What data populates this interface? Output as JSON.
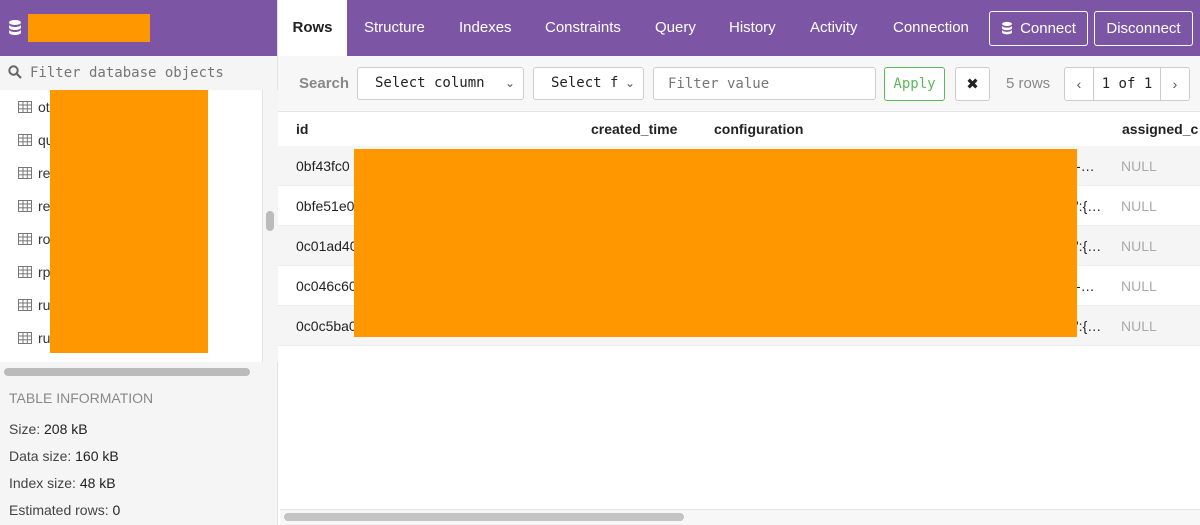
{
  "sidebar": {
    "filter_placeholder": "Filter database objects",
    "items": [
      {
        "label": "ot"
      },
      {
        "label": "qu"
      },
      {
        "label": "re"
      },
      {
        "label": "re"
      },
      {
        "label": "ro"
      },
      {
        "label": "rp"
      },
      {
        "label": "ru"
      },
      {
        "label": "ru"
      }
    ]
  },
  "table_info": {
    "title": "TABLE INFORMATION",
    "size_label": "Size:",
    "size_value": "208 kB",
    "data_label": "Data size:",
    "data_value": "160 kB",
    "index_label": "Index size:",
    "index_value": "48 kB",
    "est_label": "Estimated rows:",
    "est_value": "0"
  },
  "nav": {
    "tabs": [
      "Rows",
      "Structure",
      "Indexes",
      "Constraints",
      "Query",
      "History",
      "Activity",
      "Connection"
    ],
    "connect_label": "Connect",
    "disconnect_label": "Disconnect"
  },
  "toolbar": {
    "search_label": "Search",
    "column_select": "Select column",
    "filter_select": "Select f",
    "filter_placeholder": "Filter value",
    "apply_label": "Apply",
    "clear_label": "✖",
    "rows_count": "5 rows",
    "page_info": "1 of 1",
    "prev": "‹",
    "next": "›"
  },
  "grid": {
    "columns": [
      "id",
      "created_time",
      "configuration",
      "assigned_c"
    ],
    "rows": [
      {
        "id": "0bf43fc0",
        "cfg_tail": "-…",
        "assigned": "NULL"
      },
      {
        "id": "0bfe51e0",
        "cfg_tail": "':{…",
        "assigned": "NULL"
      },
      {
        "id": "0c01ad40",
        "cfg_tail": "':{…",
        "assigned": "NULL"
      },
      {
        "id": "0c046c60",
        "cfg_tail": "-…",
        "assigned": "NULL"
      },
      {
        "id": "0c0c5ba0",
        "cfg_tail": "':{…",
        "assigned": "NULL"
      }
    ]
  },
  "colors": {
    "header_purple": "#7c56a5",
    "redaction": "#ff9800",
    "apply_green": "#5cb85c"
  }
}
